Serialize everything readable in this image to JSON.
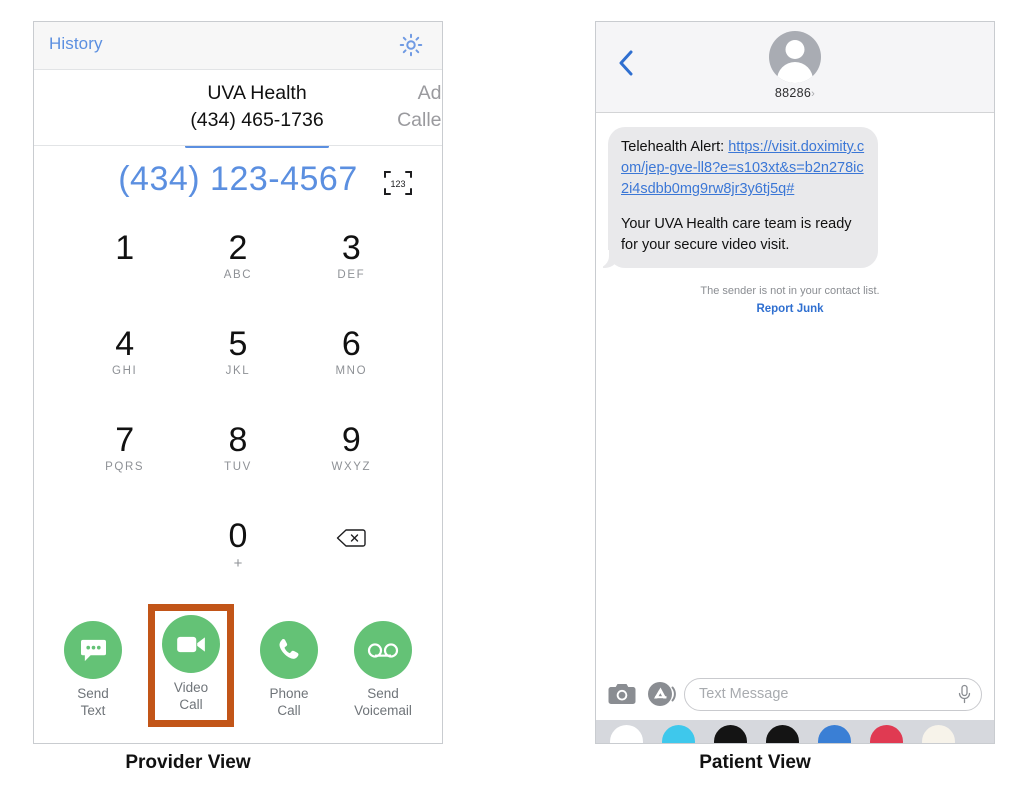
{
  "provider": {
    "caption": "Provider View",
    "topbar": {
      "history_label": "History",
      "gear_icon": "gear-icon"
    },
    "tabs": [
      {
        "line1": "UVA Health",
        "line2": "(434) 465-1736",
        "active": true
      },
      {
        "line1": "Add",
        "line2": "Caller ID",
        "active": false
      }
    ],
    "dialed_number": "(434) 123-4567",
    "scan_icon_label": "123",
    "keys": [
      {
        "digit": "1",
        "letters": ""
      },
      {
        "digit": "2",
        "letters": "ABC"
      },
      {
        "digit": "3",
        "letters": "DEF"
      },
      {
        "digit": "4",
        "letters": "GHI"
      },
      {
        "digit": "5",
        "letters": "JKL"
      },
      {
        "digit": "6",
        "letters": "MNO"
      },
      {
        "digit": "7",
        "letters": "PQRS"
      },
      {
        "digit": "8",
        "letters": "TUV"
      },
      {
        "digit": "9",
        "letters": "WXYZ"
      },
      {
        "digit": "0",
        "letters": "+"
      }
    ],
    "delete_icon": "backspace-icon",
    "actions": [
      {
        "label": "Send\nText",
        "icon": "message-bubble-icon",
        "highlighted": false
      },
      {
        "label": "Video\nCall",
        "icon": "video-camera-icon",
        "highlighted": true
      },
      {
        "label": "Phone\nCall",
        "icon": "phone-handset-icon",
        "highlighted": false
      },
      {
        "label": "Send\nVoicemail",
        "icon": "voicemail-icon",
        "highlighted": false
      }
    ],
    "colors": {
      "accent_blue": "#5b8fe0",
      "action_green": "#64c276",
      "highlight_orange": "#c25518"
    }
  },
  "patient": {
    "caption": "Patient View",
    "topbar": {
      "back_icon": "back-chevron-icon",
      "avatar_icon": "contact-avatar-icon",
      "sender": "88286",
      "sender_chevron": "›"
    },
    "message": {
      "prefix": "Telehealth Alert: ",
      "link_text": "https://visit.doximity.com/jep-gve-ll8?e=s103xt&s=b2n278ic2i4sdbb0mg9rw8jr3y6tj5q#",
      "body": "Your UVA Health care team is ready for your secure video visit."
    },
    "notice": "The sender is not in your contact list.",
    "report_junk": "Report Junk",
    "composer": {
      "camera_icon": "camera-icon",
      "app_store_icon": "app-store-icon",
      "placeholder": "Text Message",
      "mic_icon": "microphone-icon"
    },
    "app_drawer_colors": [
      "#ffffff",
      "#3ec8ec",
      "#141414",
      "#141414",
      "#3a7fd5",
      "#e03a52",
      "#f7f3ea"
    ],
    "colors": {
      "link_blue": "#3b77d6",
      "bubble_gray": "#e9e9eb"
    }
  }
}
